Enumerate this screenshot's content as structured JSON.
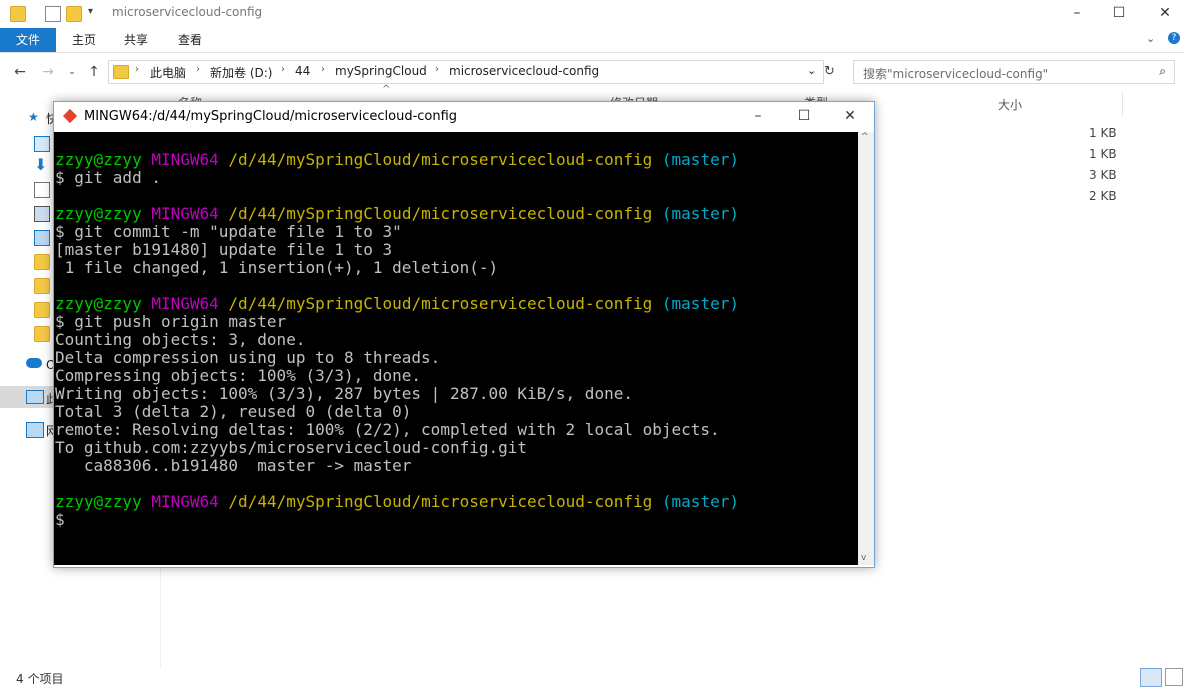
{
  "explorer": {
    "title": "microservicecloud-config",
    "ribbon_tabs": [
      "文件",
      "主页",
      "共享",
      "查看"
    ],
    "breadcrumbs": [
      "此电脑",
      "新加卷 (D:)",
      "44",
      "mySpringCloud",
      "microservicecloud-config"
    ],
    "search_placeholder": "搜索\"microservicecloud-config\"",
    "columns": {
      "name": "名称",
      "date": "修改日期",
      "type": "类型",
      "size": "大小"
    },
    "file_sizes": [
      "1 KB",
      "1 KB",
      "3 KB",
      "2 KB"
    ],
    "status": "4 个项目",
    "nav_fragments": {
      "quick": "快",
      "pc": "此",
      "net": "网",
      "onedrive": "O"
    }
  },
  "terminal": {
    "title": "MINGW64:/d/44/mySpringCloud/microservicecloud-config",
    "prompt": {
      "user": "zzyy@zzyy",
      "host": "MINGW64",
      "path": "/d/44/mySpringCloud/microservicecloud-config",
      "branch": "(master)"
    },
    "lines": [
      "$ git add .",
      "$ git commit -m \"update file 1 to 3\"",
      "[master b191480] update file 1 to 3",
      " 1 file changed, 1 insertion(+), 1 deletion(-)",
      "$ git push origin master",
      "Counting objects: 3, done.",
      "Delta compression using up to 8 threads.",
      "Compressing objects: 100% (3/3), done.",
      "Writing objects: 100% (3/3), 287 bytes | 287.00 KiB/s, done.",
      "Total 3 (delta 2), reused 0 (delta 0)",
      "remote: Resolving deltas: 100% (2/2), completed with 2 local objects.",
      "To github.com:zzyybs/microservicecloud-config.git",
      "   ca88306..b191480  master -> master",
      "$"
    ]
  },
  "colors": {
    "accent": "#1979ca",
    "term_user": "#00c800",
    "term_host": "#c000c0",
    "term_path": "#c8b400",
    "term_branch": "#00aac8"
  }
}
